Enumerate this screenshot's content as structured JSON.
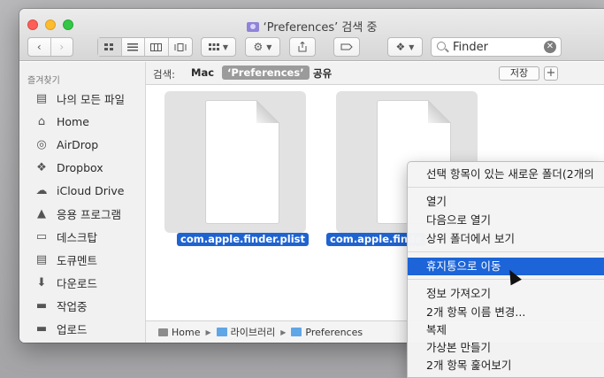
{
  "window": {
    "title": "‘Preferences’ 검색 중"
  },
  "toolbar": {
    "search_value": "Finder"
  },
  "sidebar": {
    "header": "즐겨찾기",
    "items": [
      {
        "label": "나의 모든 파일",
        "icon": "all-files-icon"
      },
      {
        "label": "Home",
        "icon": "home-icon"
      },
      {
        "label": "AirDrop",
        "icon": "airdrop-icon"
      },
      {
        "label": "Dropbox",
        "icon": "dropbox-icon"
      },
      {
        "label": "iCloud Drive",
        "icon": "cloud-icon"
      },
      {
        "label": "응용 프로그램",
        "icon": "applications-icon"
      },
      {
        "label": "데스크탑",
        "icon": "desktop-icon"
      },
      {
        "label": "도큐멘트",
        "icon": "documents-icon"
      },
      {
        "label": "다운로드",
        "icon": "downloads-icon"
      },
      {
        "label": "작업중",
        "icon": "folder-icon"
      },
      {
        "label": "업로드",
        "icon": "folder-icon"
      }
    ]
  },
  "scope": {
    "label": "검색:",
    "options": [
      "Mac",
      "‘Preferences’",
      "공유"
    ],
    "selected": "‘Preferences’",
    "save": "저장",
    "add": "+"
  },
  "files": [
    {
      "name": "com.apple.finder.plist"
    },
    {
      "name": "com.apple.finde"
    }
  ],
  "pathbar": [
    "Home",
    "라이브러리",
    "Preferences"
  ],
  "context_menu": {
    "items": [
      "선택 항목이 있는 새로운 폴더(2개의",
      "열기",
      "다음으로 열기",
      "상위 폴더에서 보기",
      "휴지통으로 이동",
      "정보 가져오기",
      "2개 항목 이름 변경...",
      "복제",
      "가상본 만들기",
      "2개 항목 훑어보기"
    ],
    "highlighted": "휴지통으로 이동"
  }
}
